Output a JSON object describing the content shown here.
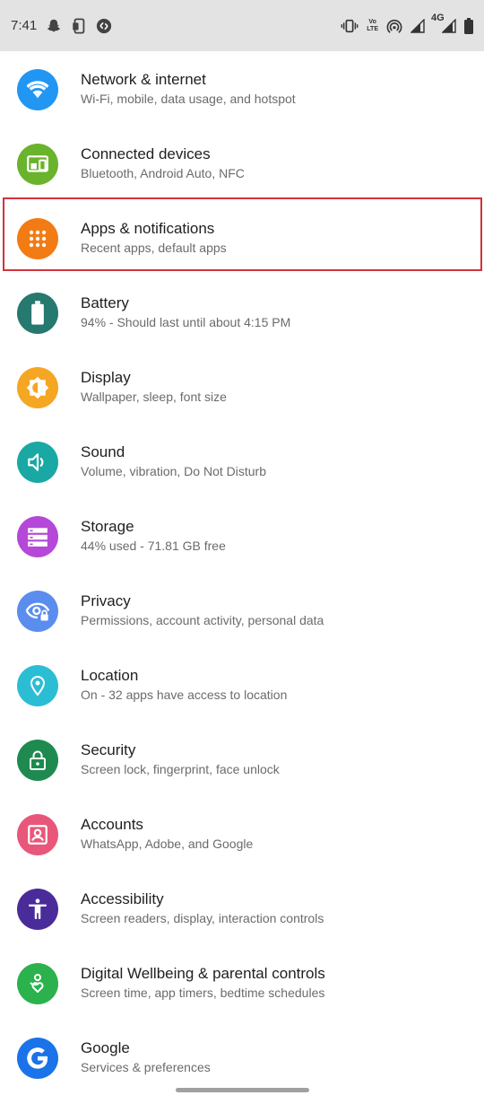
{
  "status_bar": {
    "time": "7:41",
    "left_icons": [
      "snapchat-icon",
      "phone-clone-icon",
      "shazam-icon"
    ],
    "right_icons": [
      "vibrate-icon",
      "volte-icon",
      "hotspot-icon",
      "signal-icon",
      "signal-4g-icon",
      "battery-icon"
    ],
    "volte_line1": "Vo",
    "volte_line2": "LTE",
    "network_type": "4G"
  },
  "settings": [
    {
      "title": "Network & internet",
      "subtitle": "Wi-Fi, mobile, data usage, and hotspot",
      "icon": "wifi-icon",
      "color": "#2196f3"
    },
    {
      "title": "Connected devices",
      "subtitle": "Bluetooth, Android Auto, NFC",
      "icon": "devices-icon",
      "color": "#6ab32c"
    },
    {
      "title": "Apps & notifications",
      "subtitle": "Recent apps, default apps",
      "icon": "apps-grid-icon",
      "color": "#f27b13"
    },
    {
      "title": "Battery",
      "subtitle": "94% - Should last until about 4:15 PM",
      "icon": "battery-icon",
      "color": "#25796f"
    },
    {
      "title": "Display",
      "subtitle": "Wallpaper, sleep, font size",
      "icon": "brightness-icon",
      "color": "#f5a623"
    },
    {
      "title": "Sound",
      "subtitle": "Volume, vibration, Do Not Disturb",
      "icon": "speaker-icon",
      "color": "#1aa8a4"
    },
    {
      "title": "Storage",
      "subtitle": "44% used - 71.81 GB free",
      "icon": "storage-icon",
      "color": "#b548d8"
    },
    {
      "title": "Privacy",
      "subtitle": "Permissions, account activity, personal data",
      "icon": "eye-lock-icon",
      "color": "#5b8def"
    },
    {
      "title": "Location",
      "subtitle": "On - 32 apps have access to location",
      "icon": "location-pin-icon",
      "color": "#2bbdd3"
    },
    {
      "title": "Security",
      "subtitle": "Screen lock, fingerprint, face unlock",
      "icon": "lock-icon",
      "color": "#1e8a4f"
    },
    {
      "title": "Accounts",
      "subtitle": "WhatsApp, Adobe, and Google",
      "icon": "account-box-icon",
      "color": "#e8577a"
    },
    {
      "title": "Accessibility",
      "subtitle": "Screen readers, display, interaction controls",
      "icon": "accessibility-icon",
      "color": "#4a2b9a"
    },
    {
      "title": "Digital Wellbeing & parental controls",
      "subtitle": "Screen time, app timers, bedtime schedules",
      "icon": "wellbeing-icon",
      "color": "#2bb24c"
    },
    {
      "title": "Google",
      "subtitle": "Services & preferences",
      "icon": "google-g-icon",
      "color": "#1a73e8"
    }
  ],
  "highlighted_item": "Apps & notifications",
  "highlight_color": "#d2323c"
}
